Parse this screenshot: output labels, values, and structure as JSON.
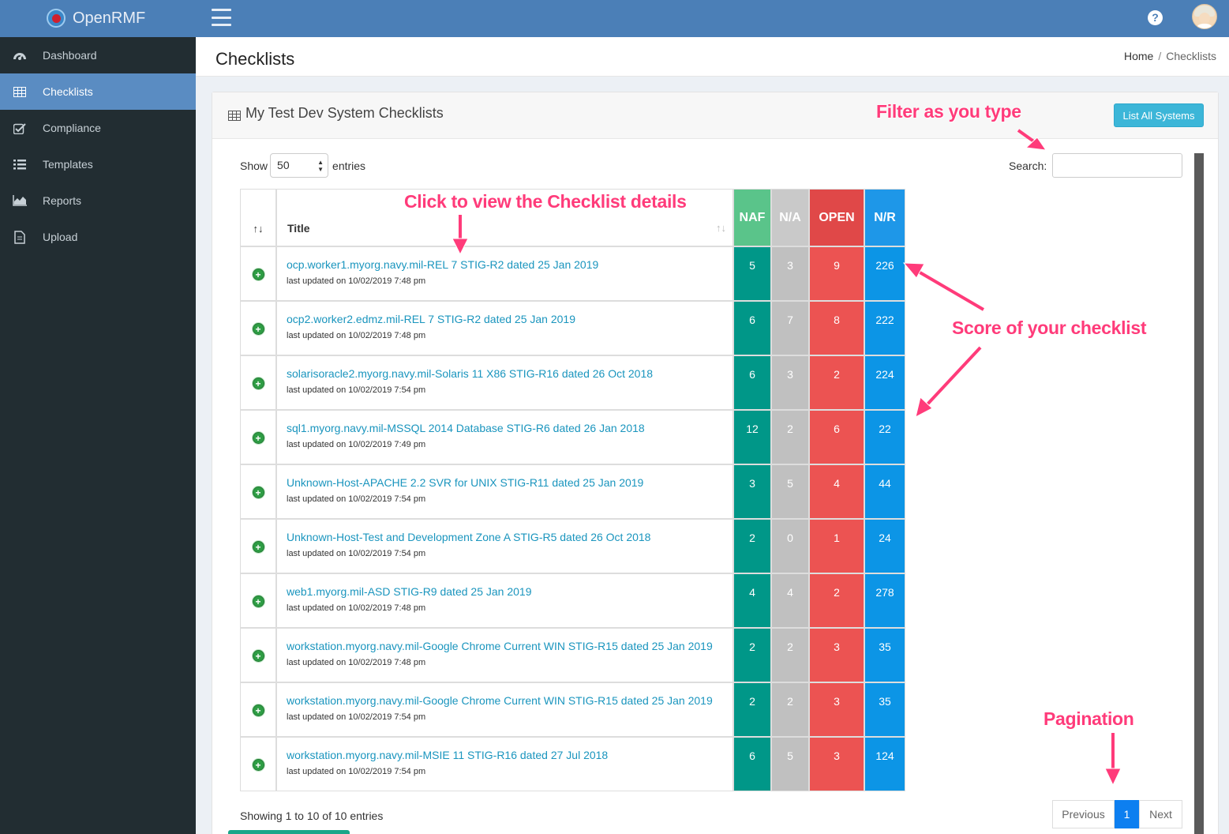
{
  "app": {
    "name": "OpenRMF"
  },
  "header": {
    "help_icon": "question-circle-icon",
    "avatar_icon": "user-avatar"
  },
  "sidebar": {
    "items": [
      {
        "label": "Dashboard",
        "icon": "dashboard-icon",
        "active": false
      },
      {
        "label": "Checklists",
        "icon": "table-icon",
        "active": true
      },
      {
        "label": "Compliance",
        "icon": "check-square-icon",
        "active": false
      },
      {
        "label": "Templates",
        "icon": "list-icon",
        "active": false
      },
      {
        "label": "Reports",
        "icon": "area-chart-icon",
        "active": false
      },
      {
        "label": "Upload",
        "icon": "file-icon",
        "active": false
      }
    ]
  },
  "page": {
    "title": "Checklists",
    "breadcrumb": [
      "Home",
      "Checklists"
    ]
  },
  "box": {
    "title": "My Test Dev System Checklists",
    "list_all_button": "List All Systems"
  },
  "controls": {
    "show_label": "Show",
    "entries_value": "50",
    "entries_label": "entries",
    "search_label": "Search:",
    "search_value": ""
  },
  "table": {
    "columns": {
      "sort": "↑↓",
      "title": "Title",
      "naf": "NAF",
      "na": "N/A",
      "open": "OPEN",
      "nr": "N/R"
    },
    "rows": [
      {
        "title": "ocp.worker1.myorg.navy.mil-REL 7 STIG-R2 dated 25 Jan 2019",
        "updated": "last updated on 10/02/2019 7:48 pm",
        "naf": "5",
        "na": "3",
        "open": "9",
        "nr": "226"
      },
      {
        "title": "ocp2.worker2.edmz.mil-REL 7 STIG-R2 dated 25 Jan 2019",
        "updated": "last updated on 10/02/2019 7:48 pm",
        "naf": "6",
        "na": "7",
        "open": "8",
        "nr": "222"
      },
      {
        "title": "solarisoracle2.myorg.navy.mil-Solaris 11 X86 STIG-R16 dated 26 Oct 2018",
        "updated": "last updated on 10/02/2019 7:54 pm",
        "naf": "6",
        "na": "3",
        "open": "2",
        "nr": "224"
      },
      {
        "title": "sql1.myorg.navy.mil-MSSQL 2014 Database STIG-R6 dated 26 Jan 2018",
        "updated": "last updated on 10/02/2019 7:49 pm",
        "naf": "12",
        "na": "2",
        "open": "6",
        "nr": "22"
      },
      {
        "title": "Unknown-Host-APACHE 2.2 SVR for UNIX STIG-R11 dated 25 Jan 2019",
        "updated": "last updated on 10/02/2019 7:54 pm",
        "naf": "3",
        "na": "5",
        "open": "4",
        "nr": "44"
      },
      {
        "title": "Unknown-Host-Test and Development Zone A STIG-R5 dated 26 Oct 2018",
        "updated": "last updated on 10/02/2019 7:54 pm",
        "naf": "2",
        "na": "0",
        "open": "1",
        "nr": "24"
      },
      {
        "title": "web1.myorg.mil-ASD STIG-R9 dated 25 Jan 2019",
        "updated": "last updated on 10/02/2019 7:48 pm",
        "naf": "4",
        "na": "4",
        "open": "2",
        "nr": "278"
      },
      {
        "title": "workstation.myorg.navy.mil-Google Chrome Current WIN STIG-R15 dated 25 Jan 2019",
        "updated": "last updated on 10/02/2019 7:48 pm",
        "naf": "2",
        "na": "2",
        "open": "3",
        "nr": "35"
      },
      {
        "title": "workstation.myorg.navy.mil-Google Chrome Current WIN STIG-R15 dated 25 Jan 2019",
        "updated": "last updated on 10/02/2019 7:54 pm",
        "naf": "2",
        "na": "2",
        "open": "3",
        "nr": "35"
      },
      {
        "title": "workstation.myorg.navy.mil-MSIE 11 STIG-R16 dated 27 Jul 2018",
        "updated": "last updated on 10/02/2019 7:54 pm",
        "naf": "6",
        "na": "5",
        "open": "3",
        "nr": "124"
      }
    ]
  },
  "footer": {
    "info": "Showing 1 to 10 of 10 entries",
    "pagination": {
      "previous": "Previous",
      "current": "1",
      "next": "Next"
    }
  },
  "annotations": {
    "filter": "Filter as you type",
    "click": "Click to view the Checklist details",
    "score": "Score of your checklist",
    "pagination": "Pagination"
  },
  "colors": {
    "topbar": "#4b7fb7",
    "sidebar": "#222d32",
    "active_nav": "#5a8cc2",
    "naf": "#009788",
    "na": "#c0c0c0",
    "open": "#ec5352",
    "nr": "#0c95e6",
    "annotation": "#ff3b7a"
  }
}
